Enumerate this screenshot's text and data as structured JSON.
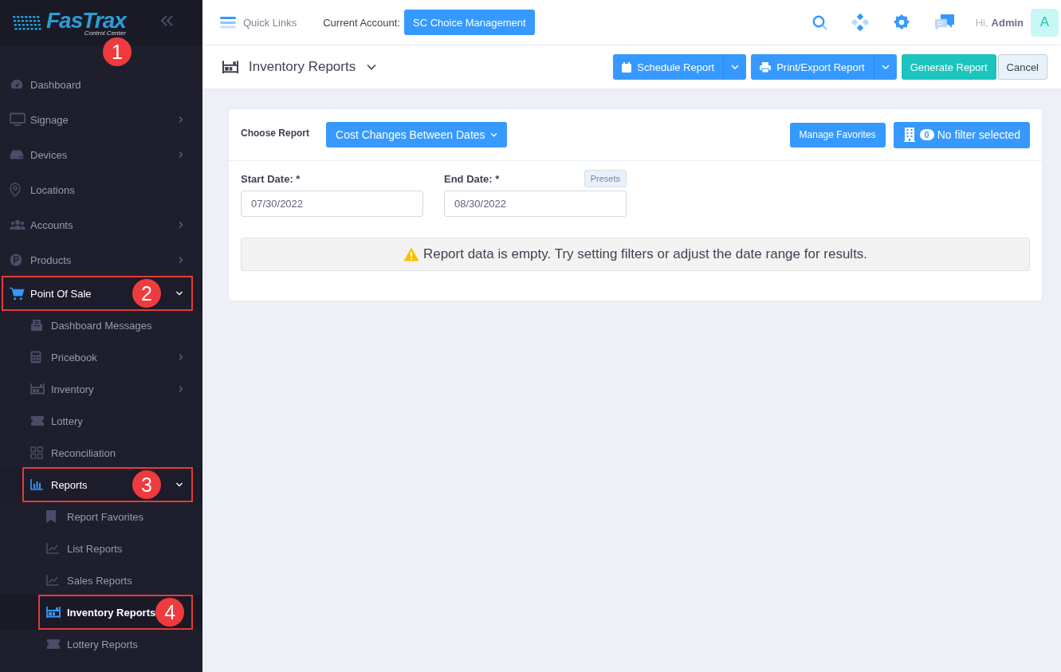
{
  "sidebar": {
    "logo": {
      "name": "FasTrax",
      "tagline": "Control Center",
      "callout": "1"
    },
    "items": [
      {
        "label": "Dashboard",
        "kind": "link",
        "active": false,
        "selected": false
      },
      {
        "label": "Signage",
        "kind": "group",
        "expanded": false,
        "active": false,
        "selected": false
      },
      {
        "label": "Devices",
        "kind": "group",
        "expanded": false,
        "active": false,
        "selected": false
      },
      {
        "label": "Locations",
        "kind": "link",
        "active": false,
        "selected": false
      },
      {
        "label": "Accounts",
        "kind": "group",
        "expanded": false,
        "active": false,
        "selected": false
      },
      {
        "label": "Products",
        "kind": "group",
        "expanded": false,
        "active": false,
        "selected": false
      },
      {
        "label": "Point Of Sale",
        "kind": "group",
        "expanded": true,
        "active": true,
        "selected": false,
        "callout": "2",
        "children": [
          {
            "label": "Dashboard Messages",
            "kind": "link",
            "active": false,
            "selected": false
          },
          {
            "label": "Pricebook",
            "kind": "group",
            "expanded": false,
            "active": false,
            "selected": false
          },
          {
            "label": "Inventory",
            "kind": "group",
            "expanded": false,
            "active": false,
            "selected": false
          },
          {
            "label": "Lottery",
            "kind": "link",
            "active": false,
            "selected": false
          },
          {
            "label": "Reconciliation",
            "kind": "link",
            "active": false,
            "selected": false
          },
          {
            "label": "Reports",
            "kind": "group",
            "expanded": true,
            "active": true,
            "selected": false,
            "callout": "3",
            "children": [
              {
                "label": "Report Favorites",
                "kind": "link",
                "active": false,
                "selected": false
              },
              {
                "label": "List Reports",
                "kind": "link",
                "active": false,
                "selected": false
              },
              {
                "label": "Sales Reports",
                "kind": "link",
                "active": false,
                "selected": false
              },
              {
                "label": "Inventory Reports",
                "kind": "link",
                "active": true,
                "selected": true,
                "callout": "4"
              },
              {
                "label": "Lottery Reports",
                "kind": "link",
                "active": false,
                "selected": false
              }
            ]
          }
        ]
      }
    ]
  },
  "topbar": {
    "quick_links": "Quick Links",
    "account_label": "Current Account:",
    "account": "SC Choice Management",
    "greeting": "Hi,",
    "user": "Admin",
    "avatar": "A"
  },
  "page_header": {
    "title": "Inventory Reports",
    "actions": [
      {
        "label": "Schedule Report",
        "kind": "split"
      },
      {
        "label": "Print/Export Report",
        "kind": "split"
      },
      {
        "label": "Generate Report",
        "kind": "primary"
      },
      {
        "label": "Cancel",
        "kind": "secondary"
      }
    ]
  },
  "report": {
    "choose_label": "Choose Report",
    "report": "Cost Changes Between Dates",
    "manage_favorites": "Manage Favorites",
    "filter_count": "0",
    "filter_label": "No filter selected",
    "start_label": "Start Date: *",
    "start_value": "07/30/2022",
    "end_label": "End Date: *",
    "end_value": "08/30/2022",
    "presets": "Presets",
    "message": "Report data is empty. Try setting filters or adjust the date range for results."
  }
}
